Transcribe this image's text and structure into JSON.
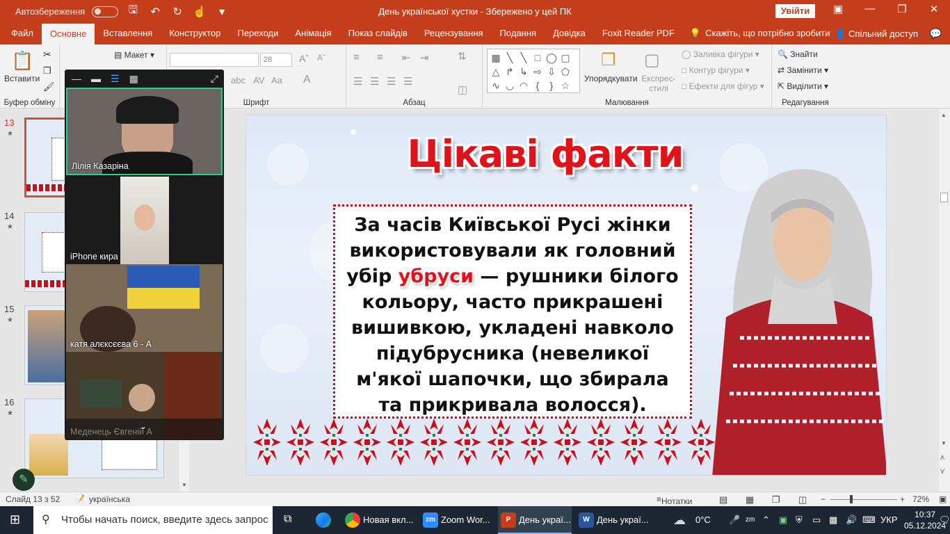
{
  "titlebar": {
    "autosave_label": "Автозбереження",
    "doc_title": "День української хустки  -  Збережено у цей ПК",
    "signin_label": "Увійти"
  },
  "tabs": {
    "file": "Файл",
    "home": "Основне",
    "insert": "Вставлення",
    "design": "Конструктор",
    "transitions": "Переходи",
    "animations": "Анімація",
    "slideshow": "Показ слайдів",
    "review": "Рецензування",
    "view": "Подання",
    "help": "Довідка",
    "foxit": "Foxit Reader PDF",
    "tellme": "Скажіть, що потрібно зробити",
    "share": "Спільний доступ"
  },
  "ribbon": {
    "paste": "Вставити",
    "clipboard": "Буфер обміну",
    "layout": "Макет",
    "font_group": "Шрифт",
    "font_size": "28",
    "paragraph_group": "Абзац",
    "arrange": "Упорядкувати",
    "quick_styles": "Експрес-стилі",
    "shape_fill": "Заливка фігури",
    "shape_outline": "Контур фігури",
    "shape_effects": "Ефекти для фігур",
    "drawing_group": "Малювання",
    "find": "Знайти",
    "replace": "Замінити",
    "select": "Виділити",
    "editing_group": "Редагування"
  },
  "thumbnails": [
    {
      "num": "13"
    },
    {
      "num": "14"
    },
    {
      "num": "15"
    },
    {
      "num": "16"
    }
  ],
  "zoom": {
    "participants": [
      {
        "name": "Лілія Казаріна"
      },
      {
        "name": "iPhone кира"
      },
      {
        "name": "катя алєксєєва 6 - А"
      },
      {
        "name": "Меденець Євгеній А"
      }
    ]
  },
  "slide": {
    "title": "Цікаві факти",
    "text_before": "За часів Київської Русі жінки використовували як головний убір ",
    "highlight": "убруси",
    "text_after": " — рушники білого кольору, часто прикрашені вишивкою, укладені навколо підубрусника (невеликої м'якої шапочки, що збирала та прикривала волосся)."
  },
  "status": {
    "slide_counter": "Слайд 13 з 52",
    "language": "українська",
    "notes": "Нотатки",
    "zoom_level": "72%"
  },
  "taskbar": {
    "search_placeholder": "Чтобы начать поиск, введите здесь запрос",
    "apps": [
      {
        "label": "Новая вкл..."
      },
      {
        "label": "Zoom Wor..."
      },
      {
        "label": "День украї..."
      },
      {
        "label": "День украї..."
      }
    ],
    "weather": "0°C",
    "lang": "УКР",
    "time": "10:37",
    "date": "05.12.2024"
  },
  "colors": {
    "accent": "#c43e1c",
    "slide_title": "#e0131a"
  }
}
